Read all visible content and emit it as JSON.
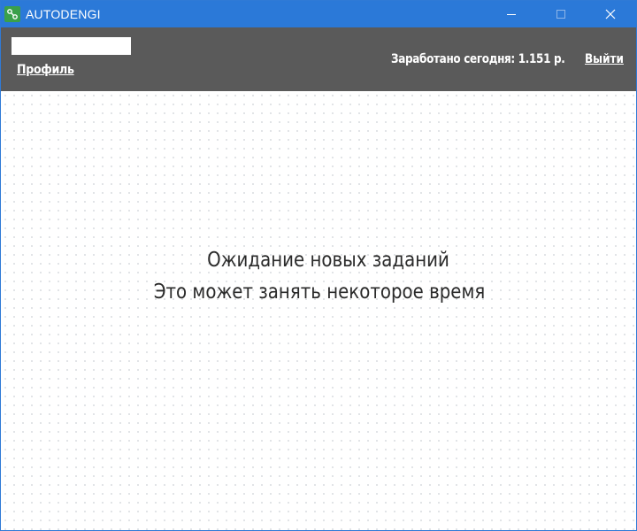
{
  "window": {
    "title": "AUTODENGI",
    "accent_color": "#2b79d8"
  },
  "header": {
    "profile_label": "Профиль",
    "earned_today": "Заработано сегодня: 1.151 р.",
    "logout_label": "Выйти",
    "background_color": "#5a5a5a"
  },
  "main": {
    "status_title": "Ожидание новых заданий",
    "status_subtitle": "Это может занять некоторое время"
  },
  "icons": {
    "app": "app-logo-icon",
    "minimize": "minimize-icon",
    "maximize": "maximize-icon",
    "close": "close-icon"
  }
}
